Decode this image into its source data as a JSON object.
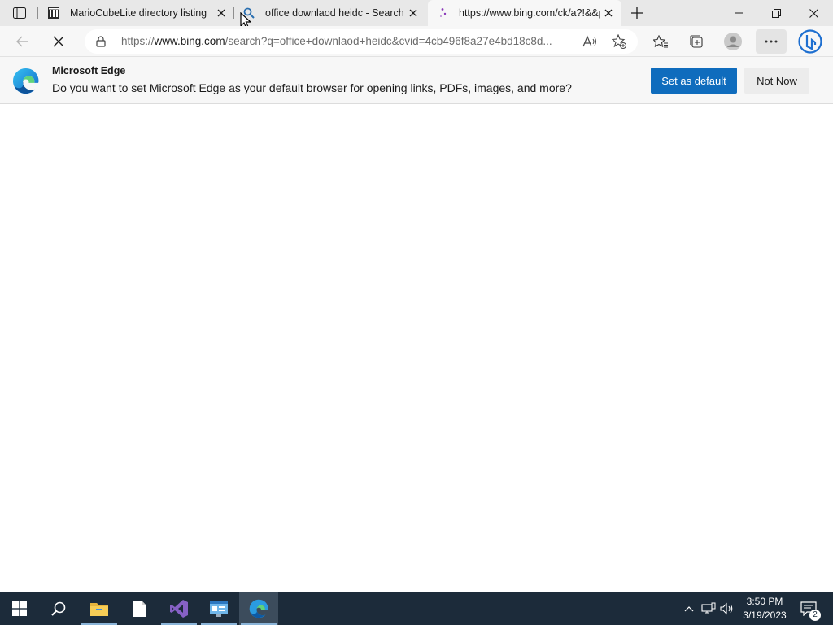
{
  "browser": {
    "tabs": [
      {
        "title": "MarioCubeLite directory listing",
        "favicon": "building-icon",
        "active": false
      },
      {
        "title": "office downlaod heidc - Search",
        "favicon": "search-icon",
        "active": false
      },
      {
        "title": "https://www.bing.com/ck/a?!&&p=",
        "favicon": "loading-icon",
        "active": true
      }
    ],
    "address_bar": {
      "url_prefix": "https://",
      "url_host": "www.bing.com",
      "url_rest": "/search?q=office+downlaod+heidc&cvid=4cb496f8a27e4bd18c8d..."
    }
  },
  "infobar": {
    "title": "Microsoft Edge",
    "message": "Do you want to set Microsoft Edge as your default browser for opening links, PDFs, images, and more?",
    "primary_label": "Set as default",
    "secondary_label": "Not Now"
  },
  "taskbar": {
    "apps": [
      "start-icon",
      "search-icon",
      "file-explorer-icon",
      "notepad-icon",
      "visual-studio-icon",
      "control-panel-icon",
      "edge-icon"
    ],
    "clock": {
      "time": "3:50 PM",
      "date": "3/19/2023"
    },
    "notification_count": "2"
  },
  "colors": {
    "accent": "#0f6cbd",
    "taskbar": "#1c2b3a",
    "tabstrip": "#e8e8e8"
  }
}
